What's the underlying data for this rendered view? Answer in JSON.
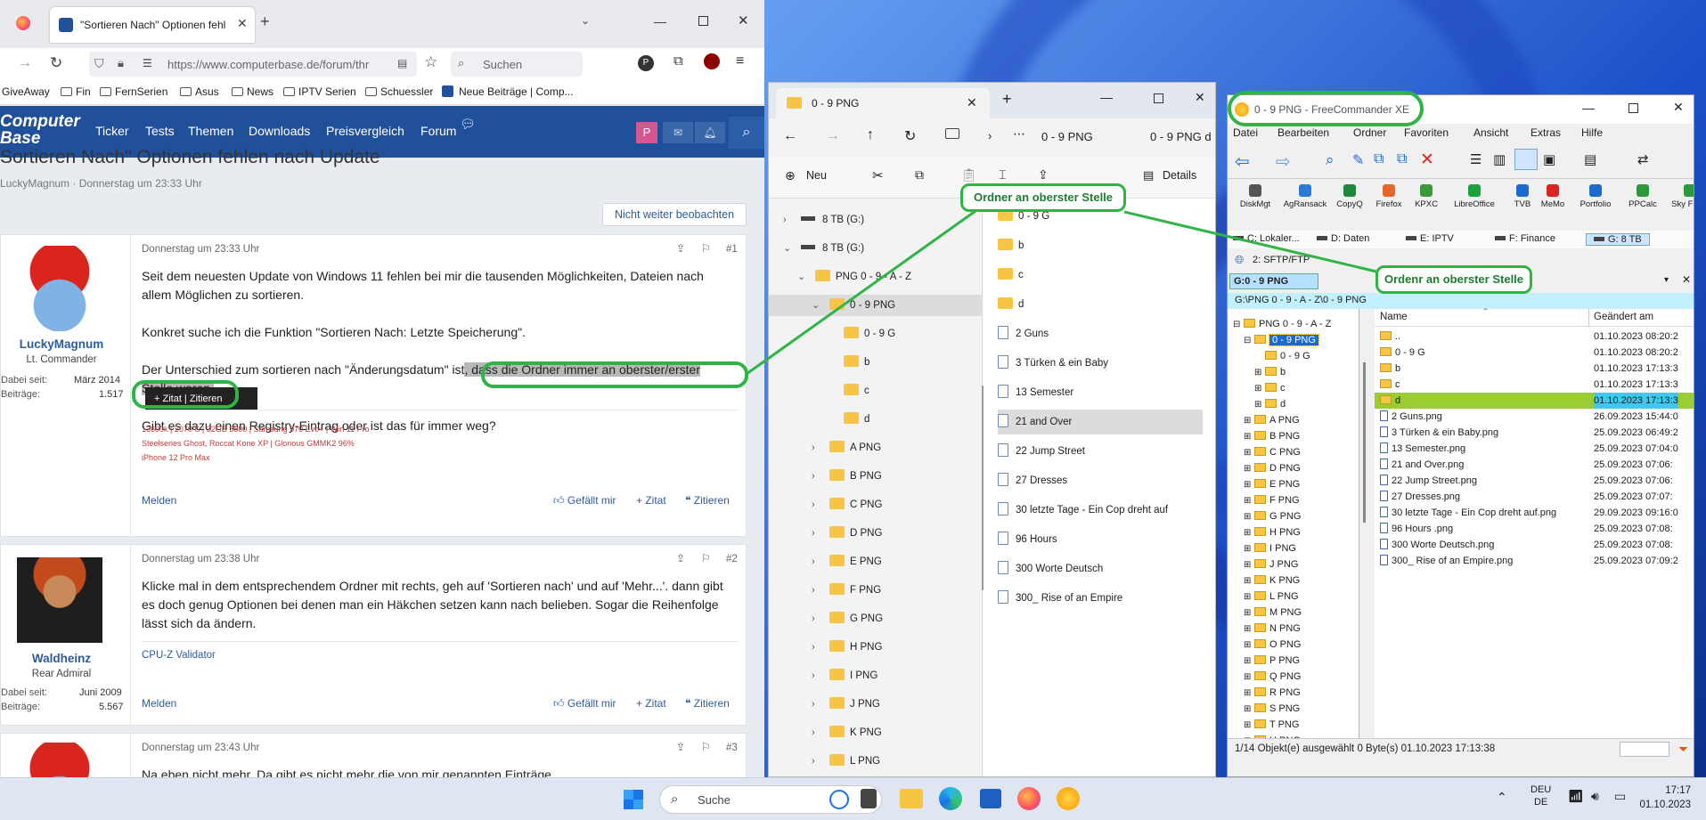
{
  "firefox": {
    "tab_title": "\"Sortieren Nach\" Optionen fehl",
    "url": "https://www.computerbase.de/forum/thr",
    "search_placeholder": "Suchen",
    "bookmarks": [
      "GiveAway",
      "Fin",
      "FernSerien",
      "Asus",
      "News",
      "IPTV Serien",
      "Schuessler",
      "Neue Beiträge | Comp..."
    ]
  },
  "site": {
    "logo_line1": "Computer",
    "logo_line2": "Base",
    "nav": [
      "Ticker",
      "Tests",
      "Themen",
      "Downloads",
      "Preisvergleich",
      "Forum"
    ],
    "avatar_letter": "P",
    "thread_title": "Sortieren Nach\" Optionen fehlen nach Update",
    "thread_meta": "LuckyMagnum · Donnerstag um 23:33 Uhr",
    "watch_button": "Nicht weiter beobachten"
  },
  "posts": [
    {
      "time": "Donnerstag um 23:33 Uhr",
      "num": "#1",
      "user": "LuckyMagnum",
      "rank": "Lt. Commander",
      "since_label": "Dabei seit:",
      "since": "März 2014",
      "posts_label": "Beiträge:",
      "posts": "1.517",
      "p1": "Seit dem neuesten Update von Windows 11 fehlen bei mir die tausenden Möglichkeiten, Dateien nach allem Möglichen zu sortieren.",
      "p2": "Konkret suche ich die Funktion \"Sortieren Nach: Letzte Speicherung\".",
      "p3a": "Der Unterschied zum sortieren nach \"Änderungsdatum\" ist",
      "p3b": ", dass die Ordner immer an oberster/erster",
      "p3c": "Stelle waren.",
      "p4": "Gibt es dazu einen Registry-Eintrag oder ist das für immer weg?",
      "sig1": "13600k | 2070 S | 32GB 3800 | Samsung 970 Evo+ | Win 11 Pro",
      "sig2": "Steelseries Ghost, Roccat Kone XP | Glorious GMMK2 96%",
      "sig3": "iPhone 12 Pro Max",
      "popup_zitat": "+ Zitat",
      "popup_zitieren": "Zitieren"
    },
    {
      "time": "Donnerstag um 23:38 Uhr",
      "num": "#2",
      "user": "Waldheinz",
      "rank": "Rear Admiral",
      "since_label": "Dabei seit:",
      "since": "Juni 2009",
      "posts_label": "Beiträge:",
      "posts": "5.567",
      "p1": "Klicke mal in dem entsprechendem Ordner mit rechts, geh auf 'Sortieren nach' und auf 'Mehr...'. dann gibt es doch genug Optionen bei denen man ein Häkchen setzen kann nach belieben. Sogar die Reihenfolge lässt sich da ändern.",
      "sig1": "CPU-Z Validator"
    },
    {
      "time": "Donnerstag um 23:43 Uhr",
      "num": "#3",
      "p1": "Na eben nicht mehr. Da gibt es nicht mehr die von mir genannten Einträge."
    }
  ],
  "actions": {
    "report": "Melden",
    "like": "Gefällt mir",
    "quote": "+ Zitat",
    "cite": "Zitieren"
  },
  "explorer": {
    "tab_title": "0 - 9 PNG",
    "breadcrumb": "0 - 9 PNG",
    "breadcrumb2": "0 - 9 PNG d",
    "new_label": "Neu",
    "details_label": "Details",
    "tree": [
      {
        "label": "8 TB (G:)",
        "lvl": 0,
        "kind": "drive",
        "exp": ">"
      },
      {
        "label": "8 TB (G:)",
        "lvl": 0,
        "kind": "drive",
        "exp": "v"
      },
      {
        "label": "PNG 0 - 9 - A - Z",
        "lvl": 1,
        "kind": "folder",
        "exp": "v"
      },
      {
        "label": "0 - 9 PNG",
        "lvl": 2,
        "kind": "folder",
        "exp": "v",
        "sel": true
      },
      {
        "label": "0 - 9 G",
        "lvl": 3,
        "kind": "folder",
        "exp": ""
      },
      {
        "label": "b",
        "lvl": 3,
        "kind": "folder",
        "exp": ""
      },
      {
        "label": "c",
        "lvl": 3,
        "kind": "folder",
        "exp": ""
      },
      {
        "label": "d",
        "lvl": 3,
        "kind": "folder",
        "exp": ""
      },
      {
        "label": "A PNG",
        "lvl": 2,
        "kind": "folder",
        "exp": ">"
      },
      {
        "label": "B PNG",
        "lvl": 2,
        "kind": "folder",
        "exp": ">"
      },
      {
        "label": "C PNG",
        "lvl": 2,
        "kind": "folder",
        "exp": ">"
      },
      {
        "label": "D PNG",
        "lvl": 2,
        "kind": "folder",
        "exp": ">"
      },
      {
        "label": "E PNG",
        "lvl": 2,
        "kind": "folder",
        "exp": ">"
      },
      {
        "label": "F PNG",
        "lvl": 2,
        "kind": "folder",
        "exp": ">"
      },
      {
        "label": "G PNG",
        "lvl": 2,
        "kind": "folder",
        "exp": ">"
      },
      {
        "label": "H PNG",
        "lvl": 2,
        "kind": "folder",
        "exp": ">"
      },
      {
        "label": "I PNG",
        "lvl": 2,
        "kind": "folder",
        "exp": ">"
      },
      {
        "label": "J PNG",
        "lvl": 2,
        "kind": "folder",
        "exp": ">"
      },
      {
        "label": "K PNG",
        "lvl": 2,
        "kind": "folder",
        "exp": ">"
      },
      {
        "label": "L PNG",
        "lvl": 2,
        "kind": "folder",
        "exp": ">"
      }
    ],
    "items": [
      {
        "label": "0 - 9 G",
        "kind": "folder"
      },
      {
        "label": "b",
        "kind": "folder"
      },
      {
        "label": "c",
        "kind": "folder"
      },
      {
        "label": "d",
        "kind": "folder"
      },
      {
        "label": "2 Guns",
        "kind": "file"
      },
      {
        "label": "3 Türken & ein Baby",
        "kind": "file"
      },
      {
        "label": "13 Semester",
        "kind": "file"
      },
      {
        "label": "21 and Over",
        "kind": "file",
        "sel": true
      },
      {
        "label": "22 Jump Street",
        "kind": "file"
      },
      {
        "label": "27 Dresses",
        "kind": "file"
      },
      {
        "label": "30 letzte Tage - Ein Cop dreht auf",
        "kind": "file"
      },
      {
        "label": "96 Hours",
        "kind": "file"
      },
      {
        "label": "300 Worte Deutsch",
        "kind": "file"
      },
      {
        "label": "300_ Rise of an Empire",
        "kind": "file"
      }
    ]
  },
  "fc": {
    "title": "0 - 9 PNG - FreeCommander XE",
    "menu": [
      "Datei",
      "Bearbeiten",
      "Ordner",
      "Favoriten",
      "Ansicht",
      "Extras",
      "Hilfe"
    ],
    "tools": [
      "DiskMgt",
      "AgRansack",
      "CopyQ",
      "Firefox",
      "KPXC",
      "LibreOffice",
      "TVB",
      "MeMo",
      "Portfolio",
      "PPCalc",
      "Sky Filme"
    ],
    "drives": [
      "C: Lokaler...",
      "D: Daten",
      "E: IPTV",
      "F: Finance",
      "G: 8 TB"
    ],
    "sftp": "2: SFTP/FTP",
    "panel_tab": "G:0 - 9 PNG",
    "path": "G:\\PNG 0 - 9 - A - Z\\0 - 9 PNG",
    "col_name": "Name",
    "col_date": "Geändert am",
    "tree": [
      {
        "label": "PNG 0 - 9 - A - Z",
        "lvl": 0,
        "exp": "⊟"
      },
      {
        "label": "0 - 9 PNG",
        "lvl": 1,
        "exp": "⊟",
        "sel": true
      },
      {
        "label": "0 - 9 G",
        "lvl": 2,
        "exp": ""
      },
      {
        "label": "b",
        "lvl": 2,
        "exp": "⊞"
      },
      {
        "label": "c",
        "lvl": 2,
        "exp": "⊞"
      },
      {
        "label": "d",
        "lvl": 2,
        "exp": "⊞"
      },
      {
        "label": "A PNG",
        "lvl": 1,
        "exp": "⊞"
      },
      {
        "label": "B PNG",
        "lvl": 1,
        "exp": "⊞"
      },
      {
        "label": "C PNG",
        "lvl": 1,
        "exp": "⊞"
      },
      {
        "label": "D PNG",
        "lvl": 1,
        "exp": "⊞"
      },
      {
        "label": "E PNG",
        "lvl": 1,
        "exp": "⊞"
      },
      {
        "label": "F PNG",
        "lvl": 1,
        "exp": "⊞"
      },
      {
        "label": "G PNG",
        "lvl": 1,
        "exp": "⊞"
      },
      {
        "label": "H PNG",
        "lvl": 1,
        "exp": "⊞"
      },
      {
        "label": "I PNG",
        "lvl": 1,
        "exp": "⊞"
      },
      {
        "label": "J PNG",
        "lvl": 1,
        "exp": "⊞"
      },
      {
        "label": "K PNG",
        "lvl": 1,
        "exp": "⊞"
      },
      {
        "label": "L PNG",
        "lvl": 1,
        "exp": "⊞"
      },
      {
        "label": "M PNG",
        "lvl": 1,
        "exp": "⊞"
      },
      {
        "label": "N PNG",
        "lvl": 1,
        "exp": "⊞"
      },
      {
        "label": "O PNG",
        "lvl": 1,
        "exp": "⊞"
      },
      {
        "label": "P PNG",
        "lvl": 1,
        "exp": "⊞"
      },
      {
        "label": "Q PNG",
        "lvl": 1,
        "exp": "⊞"
      },
      {
        "label": "R PNG",
        "lvl": 1,
        "exp": "⊞"
      },
      {
        "label": "S PNG",
        "lvl": 1,
        "exp": "⊞"
      },
      {
        "label": "T PNG",
        "lvl": 1,
        "exp": "⊞"
      },
      {
        "label": "U PNG",
        "lvl": 1,
        "exp": "⊞"
      }
    ],
    "rows": [
      {
        "name": "..",
        "date": "01.10.2023 08:20:2",
        "kind": "folder"
      },
      {
        "name": "0 - 9 G",
        "date": "01.10.2023 08:20:2",
        "kind": "folder"
      },
      {
        "name": "b",
        "date": "01.10.2023 17:13:3",
        "kind": "folder"
      },
      {
        "name": "c",
        "date": "01.10.2023 17:13:3",
        "kind": "folder"
      },
      {
        "name": "d",
        "date": "01.10.2023 17:13:3",
        "kind": "folder",
        "sel": true
      },
      {
        "name": "2 Guns.png",
        "date": "26.09.2023 15:44:0",
        "kind": "file"
      },
      {
        "name": "3 Türken & ein Baby.png",
        "date": "25.09.2023 06:49:2",
        "kind": "file"
      },
      {
        "name": "13 Semester.png",
        "date": "25.09.2023 07:04:0",
        "kind": "file"
      },
      {
        "name": "21 and Over.png",
        "date": "25.09.2023 07:06:",
        "kind": "file"
      },
      {
        "name": "22 Jump Street.png",
        "date": "25.09.2023 07:06:",
        "kind": "file"
      },
      {
        "name": "27 Dresses.png",
        "date": "25.09.2023 07:07:",
        "kind": "file"
      },
      {
        "name": "30 letzte Tage - Ein Cop dreht auf.png",
        "date": "29.09.2023 09:16:0",
        "kind": "file"
      },
      {
        "name": "96 Hours .png",
        "date": "25.09.2023 07:08:",
        "kind": "file"
      },
      {
        "name": "300 Worte Deutsch.png",
        "date": "25.09.2023 07:08:",
        "kind": "file"
      },
      {
        "name": "300_ Rise of an Empire.png",
        "date": "25.09.2023 07:09:2",
        "kind": "file"
      }
    ],
    "status": "1/14 Objekt(e) ausgewählt   0 Byte(s)   01.10.2023 17:13:38"
  },
  "annotations": {
    "callout1": "Ordner an oberster Stelle",
    "callout2": "Ordenr an oberster Stelle"
  },
  "taskbar": {
    "search": "Suche",
    "lang1": "DEU",
    "lang2": "DE",
    "time": "17:17",
    "date": "01.10.2023"
  },
  "colors": {
    "accent_green": "#2fb446",
    "forum_blue": "#21509a",
    "fc_selection": "#9acd32"
  }
}
